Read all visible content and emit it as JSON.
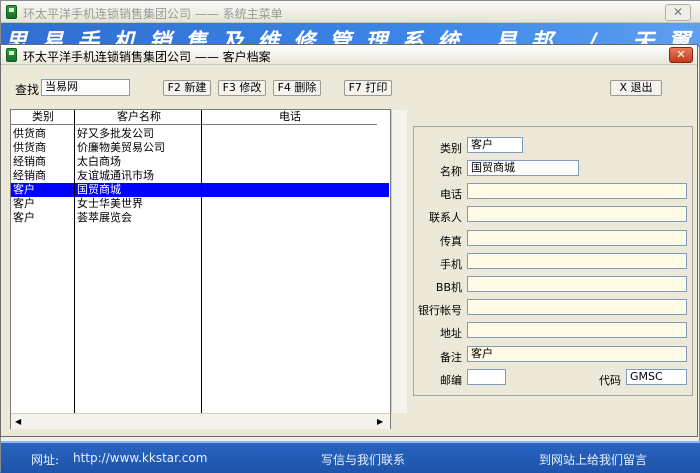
{
  "main_window": {
    "title": "环太平洋手机连锁销售集团公司 —— 系统主菜单",
    "close_label": "✕",
    "banner_text": "思易手机销售及维修管理系统 易邦 / 天翼网络版",
    "footer": {
      "url_label": "网址:",
      "url": "http://www.kkstar.com",
      "mail_link": "写信与我们联系",
      "message_link": "到网站上给我们留言"
    }
  },
  "dialog": {
    "title": "环太平洋手机连锁销售集团公司 —— 客户档案",
    "close_label": "✕",
    "search": {
      "label": "查找",
      "value": "当易网"
    },
    "toolbar": {
      "new": "F2 新建",
      "edit": "F3 修改",
      "delete": "F4 删除",
      "print": "F7 打印",
      "exit": "X 退出"
    },
    "list": {
      "columns": [
        "类别",
        "客户名称",
        "电话"
      ],
      "rows": [
        {
          "type": "供货商",
          "name": "好又多批发公司",
          "phone": ""
        },
        {
          "type": "供货商",
          "name": "价廉物美贸易公司",
          "phone": ""
        },
        {
          "type": "经销商",
          "name": "太白商场",
          "phone": ""
        },
        {
          "type": "经销商",
          "name": "友谊城通讯市场",
          "phone": ""
        },
        {
          "type": "客户",
          "name": "国贸商城",
          "phone": "",
          "selected": true
        },
        {
          "type": "客户",
          "name": "女士华美世界",
          "phone": ""
        },
        {
          "type": "客户",
          "name": "荟萃展览会",
          "phone": ""
        }
      ]
    },
    "detail": {
      "labels": {
        "type": "类别",
        "name": "名称",
        "phone": "电话",
        "contact": "联系人",
        "fax": "传真",
        "mobile": "手机",
        "pager": "BB机",
        "bank": "银行帐号",
        "address": "地址",
        "remark": "备注",
        "zip": "邮编",
        "code": "代码"
      },
      "values": {
        "type": "客户",
        "name": "国贸商城",
        "phone": "",
        "contact": "",
        "fax": "",
        "mobile": "",
        "pager": "",
        "bank": "",
        "address": "",
        "remark": "客户",
        "zip": "",
        "code": "GMSC"
      }
    }
  }
}
